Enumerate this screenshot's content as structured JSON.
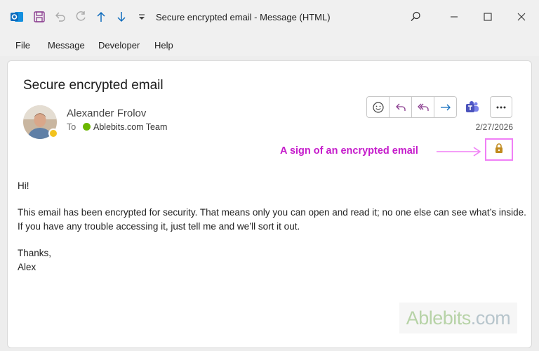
{
  "titlebar": {
    "title": "Secure encrypted email  -  Message (HTML)",
    "icons": [
      "outlook-icon",
      "save-icon",
      "undo-icon",
      "redo-icon",
      "arrow-up-icon",
      "arrow-down-icon",
      "customize-icon"
    ],
    "controls": [
      "search-icon",
      "minimize-icon",
      "maximize-icon",
      "close-icon"
    ]
  },
  "menu": {
    "items": [
      "File",
      "Message",
      "Developer",
      "Help"
    ]
  },
  "message": {
    "subject": "Secure encrypted email",
    "sender": "Alexander Frolov",
    "to_label": "To",
    "recipient": "Ablebits.com Team",
    "date": "2/27/2026",
    "actions": [
      "emoji-icon",
      "reply-icon",
      "reply-all-icon",
      "forward-icon",
      "teams-icon",
      "more-icon"
    ],
    "colors": {
      "accent": "#0f6cbd",
      "presence": "#6bb700",
      "annotation": "#c51bcb",
      "lock": "#c08a1e"
    }
  },
  "annotation": {
    "text": "A sign of an encrypted email"
  },
  "body": {
    "greeting": "Hi!",
    "line1": "This email has been encrypted for security. That means only you can open and read it; no one else can see what’s inside.",
    "line2": "If you have any trouble accessing it, just tell me and we’ll sort it out.",
    "thanks": "Thanks,",
    "signature": "Alex"
  },
  "watermark": {
    "brand": "Ablebits",
    "domain": ".com"
  }
}
